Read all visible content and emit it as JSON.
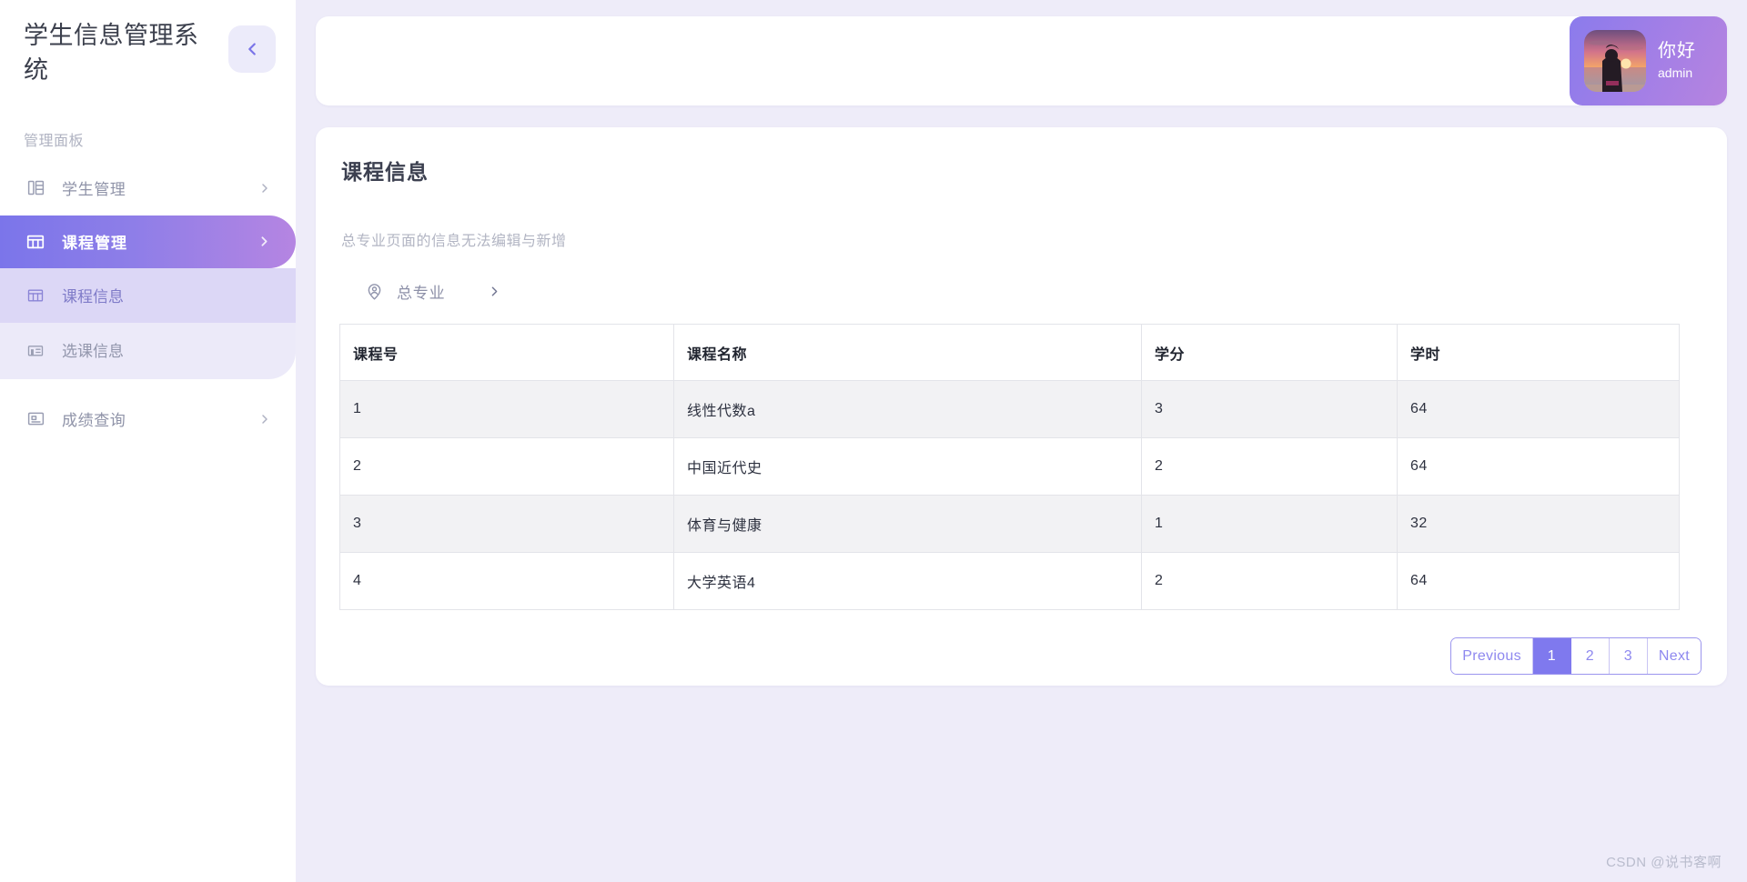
{
  "sidebar": {
    "brand_title": "学生信息管理系统",
    "collapse_icon": "chevron-left-icon",
    "panel_label": "管理面板",
    "items": [
      {
        "label": "学生管理",
        "icon": "books-icon",
        "arrow": "chevron-right-icon",
        "state": "default"
      },
      {
        "label": "课程管理",
        "icon": "table-icon",
        "arrow": "chevron-right-icon",
        "state": "active"
      }
    ],
    "submenu": [
      {
        "label": "课程信息",
        "icon": "table-icon",
        "state": "selected"
      },
      {
        "label": "选课信息",
        "icon": "chart-card-icon",
        "state": "default"
      }
    ],
    "bottom_items": [
      {
        "label": "成绩查询",
        "icon": "id-card-icon",
        "arrow": "chevron-right-icon",
        "state": "default"
      }
    ]
  },
  "header": {
    "user": {
      "greeting": "你好",
      "username": "admin",
      "avatar_icon": "sunset-beach-avatar"
    }
  },
  "content": {
    "title": "课程信息",
    "description": "总专业页面的信息无法编辑与新增",
    "breadcrumb": {
      "icon": "location-pin-user-icon",
      "label": "总专业",
      "arrow": "chevron-right-icon"
    },
    "table": {
      "columns": [
        "课程号",
        "课程名称",
        "学分",
        "学时"
      ],
      "rows": [
        [
          "1",
          "线性代数a",
          "3",
          "64"
        ],
        [
          "2",
          "中国近代史",
          "2",
          "64"
        ],
        [
          "3",
          "体育与健康",
          "1",
          "32"
        ],
        [
          "4",
          "大学英语4",
          "2",
          "64"
        ]
      ]
    },
    "pagination": {
      "previous_label": "Previous",
      "pages": [
        "1",
        "2",
        "3"
      ],
      "next_label": "Next",
      "current_page": "1"
    }
  },
  "watermark": "CSDN @说书客啊",
  "colors": {
    "accent_start": "#7b75ea",
    "accent_end": "#b585e2",
    "page_bg": "#eeecf9",
    "submenu_bg": "#eceaf9",
    "submenu_selected_bg": "#dcd7f6",
    "pager_accent": "#7f79ee"
  }
}
